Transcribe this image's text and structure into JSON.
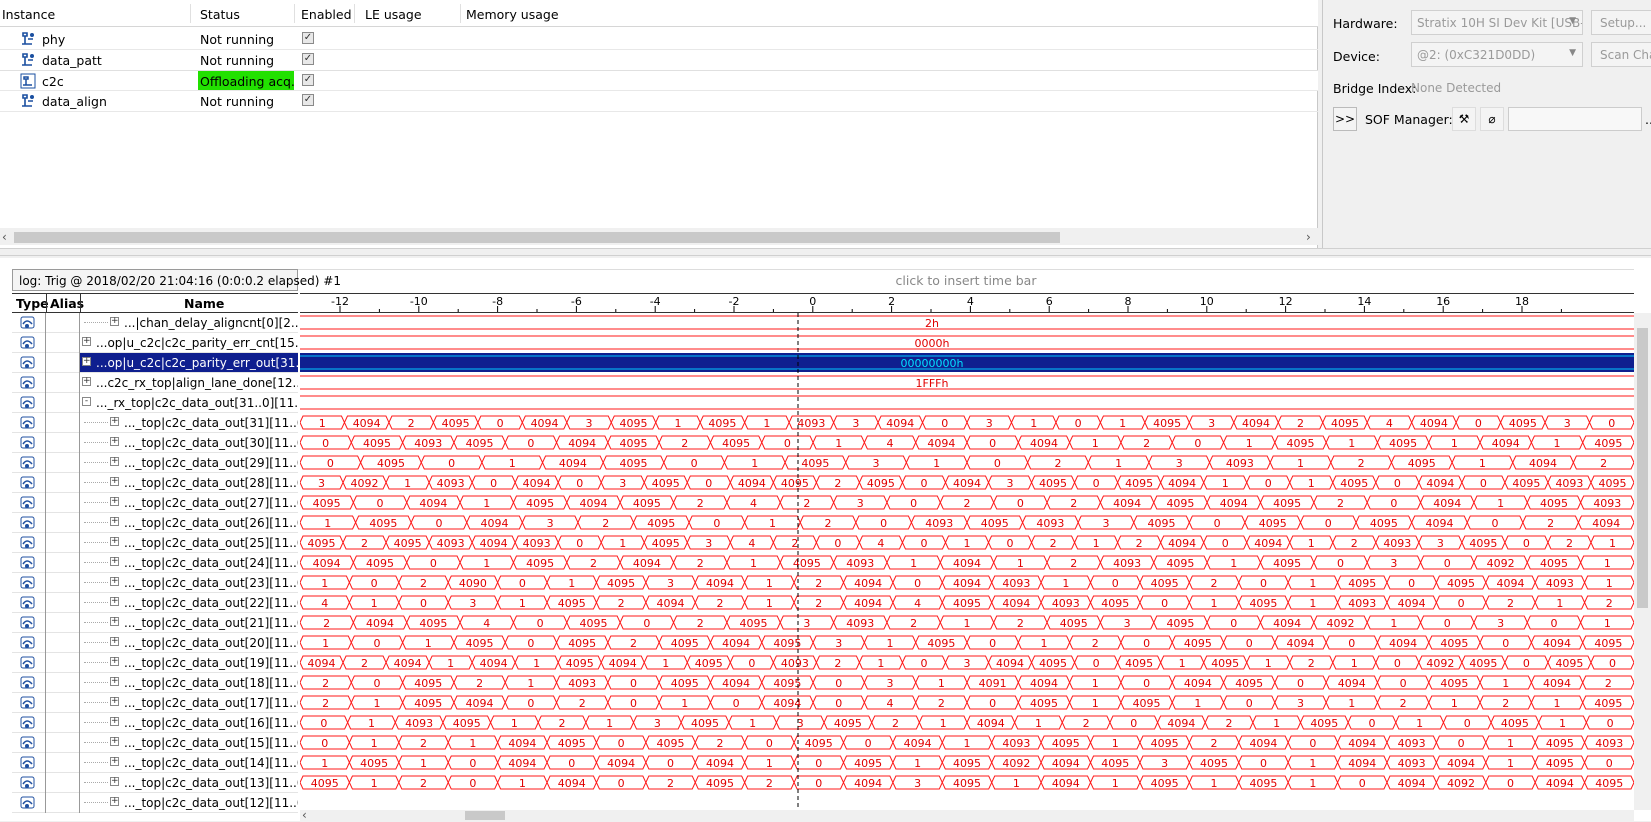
{
  "instances": {
    "columns": [
      "Instance",
      "Status",
      "Enabled",
      "LE usage",
      "Memory usage"
    ],
    "rows": [
      {
        "name": "phy",
        "status": "Not running",
        "enabled": "✓"
      },
      {
        "name": "data_patt",
        "status": "Not running",
        "enabled": "✓"
      },
      {
        "name": "c2c",
        "status": "Offloading acq...",
        "enabled": "✓"
      },
      {
        "name": "data_align",
        "status": "Not running",
        "enabled": "✓"
      }
    ]
  },
  "hardware": {
    "hardware_label": "Hardware:",
    "hardware_value": "Stratix 10H SI Dev Kit [USB-1",
    "setup_button": "Setup...",
    "device_label": "Device:",
    "device_value": "@2: (0xC321D0DD)",
    "scan_button": "Scan Chain",
    "bridge_label": "Bridge Index:",
    "bridge_value": "None Detected",
    "expand_button": ">>",
    "sof_label": "SOF Manager:",
    "sof_more": "..."
  },
  "waveform": {
    "log_tab": "log: Trig @ 2018/02/20 21:04:16 (0:0:0.2 elapsed) #1",
    "timebar_hint": "click to insert time bar",
    "headers": {
      "type": "Type",
      "alias": "Alias",
      "name": "Name"
    },
    "ruler_ticks": [
      "-12",
      "-10",
      "-8",
      "-6",
      "-4",
      "-2",
      "0",
      "2",
      "4",
      "6",
      "8",
      "10",
      "12",
      "14",
      "16",
      "18"
    ],
    "signals": [
      {
        "name": "...|chan_delay_aligncnt[0][2..0]",
        "value": "2h",
        "exp": "+",
        "indent": 2
      },
      {
        "name": "...op|u_c2c|c2c_parity_err_cnt[15..0]",
        "value": "0000h",
        "exp": "+",
        "indent": 1
      },
      {
        "name": "...op|u_c2c|c2c_parity_err_out[31..0]",
        "value": "00000000h",
        "exp": "+",
        "indent": 1,
        "selected": true
      },
      {
        "name": "...c2c_rx_top|align_lane_done[12..0]",
        "value": "1FFFh",
        "exp": "+",
        "indent": 1
      },
      {
        "name": "..._rx_top|c2c_data_out[31..0][11..0]",
        "value": "",
        "exp": "-",
        "indent": 1
      },
      {
        "name": "..._top|c2c_data_out[31][11..0]",
        "bus": [
          "1",
          "4094",
          "2",
          "4095",
          "0",
          "4094",
          "3",
          "4095",
          "1",
          "4095",
          "1",
          "4093",
          "3",
          "4094",
          "0",
          "3",
          "1",
          "0",
          "1",
          "4095",
          "3",
          "4094",
          "2",
          "4095",
          "4",
          "4094",
          "0",
          "4095",
          "3",
          "0"
        ]
      },
      {
        "name": "..._top|c2c_data_out[30][11..0]",
        "bus": [
          "0",
          "4095",
          "4093",
          "4095",
          "0",
          "4094",
          "4095",
          "2",
          "4095",
          "0",
          "1",
          "4",
          "4094",
          "0",
          "4094",
          "1",
          "2",
          "0",
          "1",
          "4095",
          "1",
          "4095",
          "1",
          "4094",
          "1",
          "4095"
        ]
      },
      {
        "name": "..._top|c2c_data_out[29][11..0]",
        "bus": [
          "0",
          "4095",
          "0",
          "1",
          "4094",
          "4095",
          "0",
          "1",
          "4095",
          "3",
          "1",
          "0",
          "2",
          "1",
          "3",
          "4093",
          "1",
          "2",
          "4095",
          "1",
          "4094",
          "2"
        ]
      },
      {
        "name": "..._top|c2c_data_out[28][11..0]",
        "bus": [
          "3",
          "4092",
          "1",
          "4093",
          "0",
          "4094",
          "0",
          "3",
          "4095",
          "0",
          "4094",
          "4095",
          "2",
          "4095",
          "0",
          "4094",
          "3",
          "4095",
          "0",
          "4095",
          "4094",
          "1",
          "0",
          "1",
          "4095",
          "0",
          "4094",
          "0",
          "4095",
          "4093",
          "4095"
        ]
      },
      {
        "name": "..._top|c2c_data_out[27][11..0]",
        "bus": [
          "4095",
          "0",
          "4094",
          "1",
          "4095",
          "4094",
          "4095",
          "2",
          "4",
          "2",
          "3",
          "0",
          "2",
          "0",
          "2",
          "4094",
          "4095",
          "4094",
          "4095",
          "2",
          "0",
          "4094",
          "1",
          "4095",
          "4093"
        ]
      },
      {
        "name": "..._top|c2c_data_out[26][11..0]",
        "bus": [
          "1",
          "4095",
          "0",
          "4094",
          "3",
          "2",
          "4095",
          "0",
          "1",
          "2",
          "0",
          "4093",
          "4095",
          "4093",
          "3",
          "4095",
          "0",
          "4095",
          "0",
          "4095",
          "4094",
          "0",
          "2",
          "4094"
        ]
      },
      {
        "name": "..._top|c2c_data_out[25][11..0]",
        "bus": [
          "4095",
          "2",
          "4095",
          "4093",
          "4094",
          "4093",
          "0",
          "1",
          "4095",
          "3",
          "4",
          "2",
          "0",
          "4",
          "0",
          "1",
          "0",
          "2",
          "1",
          "2",
          "4094",
          "0",
          "4094",
          "1",
          "2",
          "4093",
          "3",
          "4095",
          "0",
          "2",
          "1"
        ]
      },
      {
        "name": "..._top|c2c_data_out[24][11..0]",
        "bus": [
          "4094",
          "4095",
          "0",
          "1",
          "4095",
          "2",
          "4094",
          "2",
          "1",
          "4095",
          "4093",
          "1",
          "4094",
          "1",
          "2",
          "4093",
          "4095",
          "1",
          "4095",
          "0",
          "3",
          "0",
          "4092",
          "4095",
          "1"
        ]
      },
      {
        "name": "..._top|c2c_data_out[23][11..0]",
        "bus": [
          "1",
          "0",
          "2",
          "4090",
          "0",
          "1",
          "4095",
          "3",
          "4094",
          "1",
          "2",
          "4094",
          "0",
          "4094",
          "4093",
          "1",
          "0",
          "4095",
          "2",
          "0",
          "1",
          "4095",
          "0",
          "4095",
          "4094",
          "4093",
          "1"
        ]
      },
      {
        "name": "..._top|c2c_data_out[22][11..0]",
        "bus": [
          "4",
          "1",
          "0",
          "3",
          "1",
          "4095",
          "2",
          "4094",
          "2",
          "1",
          "2",
          "4094",
          "4",
          "4095",
          "4094",
          "4093",
          "4095",
          "0",
          "1",
          "4095",
          "1",
          "4093",
          "4094",
          "0",
          "2",
          "1",
          "2"
        ]
      },
      {
        "name": "..._top|c2c_data_out[21][11..0]",
        "bus": [
          "2",
          "4094",
          "4095",
          "4",
          "0",
          "4095",
          "0",
          "2",
          "4095",
          "3",
          "4093",
          "2",
          "1",
          "2",
          "4095",
          "3",
          "4095",
          "0",
          "4094",
          "4092",
          "1",
          "0",
          "3",
          "0",
          "1"
        ]
      },
      {
        "name": "..._top|c2c_data_out[20][11..0]",
        "bus": [
          "1",
          "0",
          "1",
          "4095",
          "0",
          "4095",
          "2",
          "4095",
          "4094",
          "4095",
          "3",
          "1",
          "4095",
          "0",
          "1",
          "2",
          "0",
          "4095",
          "0",
          "4094",
          "0",
          "4094",
          "4095",
          "0",
          "4094",
          "4095"
        ]
      },
      {
        "name": "..._top|c2c_data_out[19][11..0]",
        "bus": [
          "4094",
          "2",
          "4094",
          "1",
          "4094",
          "1",
          "4095",
          "4094",
          "1",
          "4095",
          "0",
          "4093",
          "2",
          "1",
          "0",
          "3",
          "4094",
          "4095",
          "0",
          "4095",
          "1",
          "4095",
          "1",
          "2",
          "1",
          "0",
          "4092",
          "4095",
          "0",
          "4095",
          "0"
        ]
      },
      {
        "name": "..._top|c2c_data_out[18][11..0]",
        "bus": [
          "2",
          "0",
          "4095",
          "2",
          "1",
          "4093",
          "0",
          "4095",
          "4094",
          "4095",
          "0",
          "3",
          "1",
          "4091",
          "4094",
          "1",
          "0",
          "4094",
          "4095",
          "0",
          "4094",
          "0",
          "4095",
          "1",
          "4094",
          "2"
        ]
      },
      {
        "name": "..._top|c2c_data_out[17][11..0]",
        "bus": [
          "2",
          "1",
          "4095",
          "4094",
          "0",
          "2",
          "0",
          "1",
          "0",
          "4094",
          "0",
          "4",
          "2",
          "0",
          "4095",
          "1",
          "4095",
          "1",
          "0",
          "3",
          "1",
          "2",
          "1",
          "2",
          "1",
          "4095"
        ]
      },
      {
        "name": "..._top|c2c_data_out[16][11..0]",
        "bus": [
          "0",
          "1",
          "4093",
          "4095",
          "1",
          "2",
          "1",
          "3",
          "4095",
          "1",
          "3",
          "4095",
          "2",
          "1",
          "4094",
          "1",
          "2",
          "0",
          "4094",
          "2",
          "1",
          "4095",
          "0",
          "1",
          "0",
          "4095",
          "1",
          "0"
        ]
      },
      {
        "name": "..._top|c2c_data_out[15][11..0]",
        "bus": [
          "0",
          "1",
          "2",
          "1",
          "4094",
          "4095",
          "0",
          "4095",
          "2",
          "0",
          "4095",
          "0",
          "4094",
          "1",
          "4093",
          "4095",
          "1",
          "4095",
          "2",
          "4094",
          "0",
          "4094",
          "4093",
          "0",
          "1",
          "4095",
          "4093"
        ]
      },
      {
        "name": "..._top|c2c_data_out[14][11..0]",
        "bus": [
          "1",
          "4095",
          "1",
          "0",
          "4094",
          "0",
          "4094",
          "0",
          "4094",
          "1",
          "0",
          "4095",
          "1",
          "4095",
          "4092",
          "4094",
          "4095",
          "3",
          "4095",
          "0",
          "1",
          "4094",
          "4093",
          "4094",
          "1",
          "4095",
          "0"
        ]
      },
      {
        "name": "..._top|c2c_data_out[13][11..0]",
        "bus": [
          "4095",
          "1",
          "2",
          "0",
          "1",
          "4094",
          "0",
          "2",
          "4095",
          "2",
          "0",
          "4094",
          "3",
          "4095",
          "1",
          "4094",
          "1",
          "4095",
          "1",
          "4095",
          "1",
          "0",
          "4094",
          "4092",
          "0",
          "4094",
          "4095"
        ]
      },
      {
        "name": "..._top|c2c_data_out[12][11..0]",
        "bus": []
      }
    ]
  }
}
